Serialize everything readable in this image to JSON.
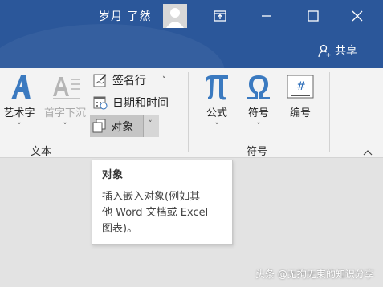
{
  "titlebar": {
    "user_name": "岁月 了然",
    "share_label": "共享",
    "bg_color": "#2b579a"
  },
  "ribbon": {
    "wordart_label": "艺术字",
    "dropcap_label": "首字下沉",
    "signature_label": "签名行",
    "datetime_label": "日期和时间",
    "object_label": "对象",
    "text_group_label": "文本",
    "formula_label": "公式",
    "symbol_label": "符号",
    "number_label": "编号",
    "symbols_group_label": "符号"
  },
  "tooltip": {
    "title": "对象",
    "line1": "插入嵌入对象(例如其",
    "line2": "他 Word 文档或 Excel",
    "line3": "图表)。"
  },
  "watermark": "头条 @无拘无束的知识分享"
}
